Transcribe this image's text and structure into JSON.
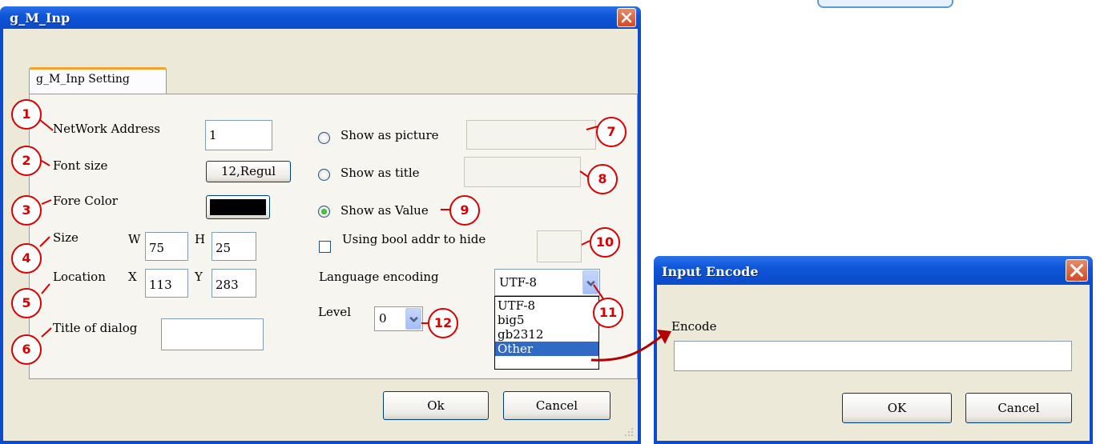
{
  "main_dialog": {
    "title": "g_M_Inp",
    "tab_label": "g_M_Inp Setting",
    "network_address": {
      "label": "NetWork Address",
      "value": "1"
    },
    "font_size": {
      "label": "Font size",
      "value": "12,Regul"
    },
    "fore_color": {
      "label": "Fore Color",
      "color": "#000000"
    },
    "size": {
      "label": "Size",
      "w_label": "W",
      "w_value": "75",
      "h_label": "H",
      "h_value": "25"
    },
    "location": {
      "label": "Location",
      "x_label": "X",
      "x_value": "113",
      "y_label": "Y",
      "y_value": "283"
    },
    "title_of_dialog": {
      "label": "Title of dialog",
      "value": ""
    },
    "show_as_picture": {
      "label": "Show as picture",
      "selected": false,
      "value": ""
    },
    "show_as_title": {
      "label": "Show as title",
      "selected": false,
      "value": ""
    },
    "show_as_value": {
      "label": "Show as Value",
      "selected": true
    },
    "bool_hide": {
      "label": "Using bool addr to hide",
      "checked": false,
      "value": ""
    },
    "language_encoding": {
      "label": "Language encoding",
      "value": "UTF-8",
      "options": [
        "UTF-8",
        "big5",
        "gb2312",
        "Other"
      ],
      "highlighted": "Other"
    },
    "level": {
      "label": "Level",
      "value": "0"
    },
    "ok_label": "Ok",
    "cancel_label": "Cancel"
  },
  "encode_dialog": {
    "title": "Input Encode",
    "encode_label": "Encode",
    "encode_value": "",
    "ok_label": "OK",
    "cancel_label": "Cancel"
  },
  "callouts": [
    "1",
    "2",
    "3",
    "4",
    "5",
    "6",
    "7",
    "8",
    "9",
    "10",
    "11",
    "12"
  ],
  "colors": {
    "callout": "#d80000",
    "titlebar": "#0a4bd0",
    "selection": "#316ac5",
    "tab_accent": "#f7a12d"
  }
}
